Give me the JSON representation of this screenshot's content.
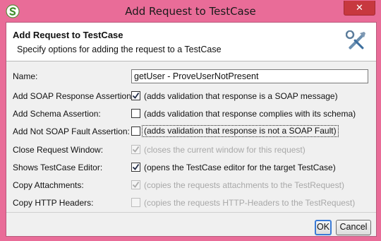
{
  "window": {
    "title": "Add Request to TestCase",
    "close_glyph": "✕"
  },
  "header": {
    "title": "Add Request to TestCase",
    "subtitle": "Specify options for adding the request to a TestCase"
  },
  "form": {
    "name_label": "Name:",
    "name_value": "getUser - ProveUserNotPresent",
    "options": [
      {
        "label": "Add SOAP Response Assertion:",
        "description": "(adds validation that response is a SOAP message)",
        "checked": true,
        "enabled": true
      },
      {
        "label": "Add Schema Assertion:",
        "description": "(adds validation that response complies with its schema)",
        "checked": false,
        "enabled": true
      },
      {
        "label": "Add Not SOAP Fault Assertion:",
        "description": "(adds validation that response is not a SOAP Fault)",
        "checked": false,
        "enabled": true,
        "focused": true
      },
      {
        "label": "Close Request Window:",
        "description": "(closes the current window for this request)",
        "checked": true,
        "enabled": false
      },
      {
        "label": "Shows TestCase Editor:",
        "description": "(opens the TestCase editor for the target TestCase)",
        "checked": true,
        "enabled": true
      },
      {
        "label": "Copy Attachments:",
        "description": "(copies the requests attachments to the TestRequest)",
        "checked": true,
        "enabled": false
      },
      {
        "label": "Copy HTTP Headers:",
        "description": "(copies the requests HTTP-Headers to the TestRequest)",
        "checked": false,
        "enabled": false
      }
    ]
  },
  "buttons": {
    "ok": "OK",
    "cancel": "Cancel"
  },
  "icons": {
    "app": "soapui-logo-icon",
    "header": "tools-icon",
    "close": "close-icon"
  },
  "colors": {
    "frame": "#E96C98",
    "close_button": "#C7383F",
    "ok_focus": "#3B7BD6"
  }
}
